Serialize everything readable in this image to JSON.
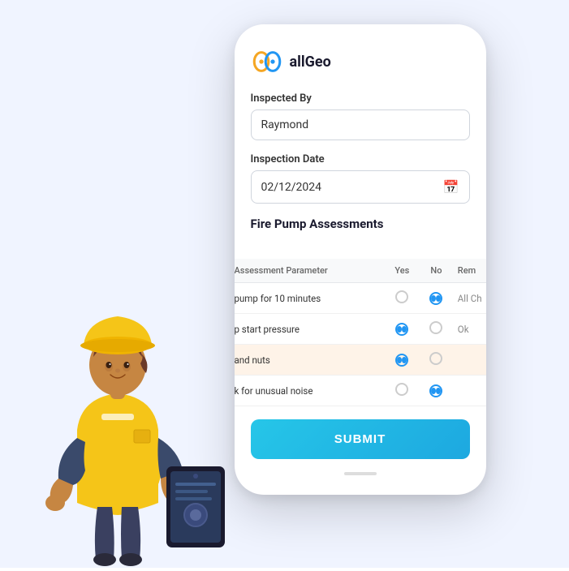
{
  "app": {
    "name": "allGeo",
    "logo_text": "allGeo"
  },
  "form": {
    "inspected_by_label": "Inspected By",
    "inspected_by_value": "Raymond",
    "inspection_date_label": "Inspection Date",
    "inspection_date_value": "02/12/2024",
    "section_title": "Fire Pump Assessments"
  },
  "table": {
    "headers": {
      "parameter": "Assessment Parameter",
      "yes": "Yes",
      "no": "No",
      "remarks": "Rem"
    },
    "rows": [
      {
        "parameter": "pump for 10 minutes",
        "yes": false,
        "no": true,
        "remarks": "All Ch"
      },
      {
        "parameter": "p start pressure",
        "yes": true,
        "no": false,
        "remarks": "Ok"
      },
      {
        "parameter": "and nuts",
        "yes": true,
        "no": false,
        "remarks": "",
        "highlighted": true
      },
      {
        "parameter": "k for unusual noise",
        "yes": false,
        "no": true,
        "remarks": ""
      }
    ]
  },
  "submit": {
    "label": "SUBMIT"
  }
}
